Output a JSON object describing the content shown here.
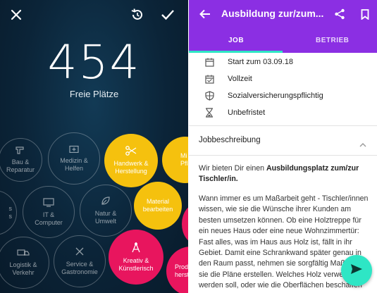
{
  "left": {
    "count": "454",
    "count_label": "Freie Plätze",
    "bubbles": [
      {
        "l1": "Bau &",
        "l2": "Reparatur",
        "icon": "hammer-drill-icon"
      },
      {
        "l1": "Medizin &",
        "l2": "Helfen",
        "icon": "medical-kit-icon"
      },
      {
        "l1": "Handwerk &",
        "l2": "Herstellung",
        "icon": "scissors-icon"
      },
      {
        "l1": "Mi",
        "l2": "Pflanz",
        "icon": "leaf-icon"
      },
      {
        "l1": "s",
        "l2": "s",
        "icon": "none"
      },
      {
        "l1": "IT &",
        "l2": "Computer",
        "icon": "monitor-icon"
      },
      {
        "l1": "Natur &",
        "l2": "Umwelt",
        "icon": "leaf-icon"
      },
      {
        "l1": "Material",
        "l2": "bearbeiten",
        "icon": "none"
      },
      {
        "l1": "Logistik &",
        "l2": "Verkehr",
        "icon": "truck-icon"
      },
      {
        "l1": "Service &",
        "l2": "Gastronomie",
        "icon": "utensils-icon"
      },
      {
        "l1": "Kreativ &",
        "l2": "Künstlerisch",
        "icon": "compass-icon"
      },
      {
        "l1": "Prod",
        "l2": "herst",
        "icon": "none"
      }
    ]
  },
  "right": {
    "title": "Ausbildung zur/zum...",
    "tabs": [
      "JOB",
      "BETRIEB"
    ],
    "info": [
      {
        "text": "Start zum 03.09.18",
        "icon": "calendar-icon"
      },
      {
        "text": "Vollzeit",
        "icon": "calendar-icon"
      },
      {
        "text": "Sozialversicherungspflichtig",
        "icon": "shield-icon"
      },
      {
        "text": "Unbefristet",
        "icon": "hourglass-icon"
      }
    ],
    "section_title": "Jobbeschreibung",
    "para1_pre": "Wir bieten Dir einen ",
    "para1_bold": "Ausbildungsplatz zum/zur Tischler/in",
    "para1_post": ".",
    "para2": "Wann immer es um Maßarbeit geht - Tischler/innen wissen, wie sie die Wünsche ihrer Kunden am besten umsetzen können. Ob eine Holztreppe für ein neues Haus oder eine neue Wohnzimmertür: Fast alles, was im Haus aus Holz ist, fällt in ihr Gebiet. Damit eine Schrankwand später genau in den Raum passt, nehmen sie sorgfältig Maß, bevor sie die Pläne erstellen. Welches Holz verwendet werden soll, oder wie die Oberflächen beschaffen sein"
  },
  "colors": {
    "purple": "#8b2fe3",
    "teal": "#2ee6c5",
    "yellow": "#f5c10e",
    "pink": "#e8155e",
    "navy": "#0b2438"
  }
}
